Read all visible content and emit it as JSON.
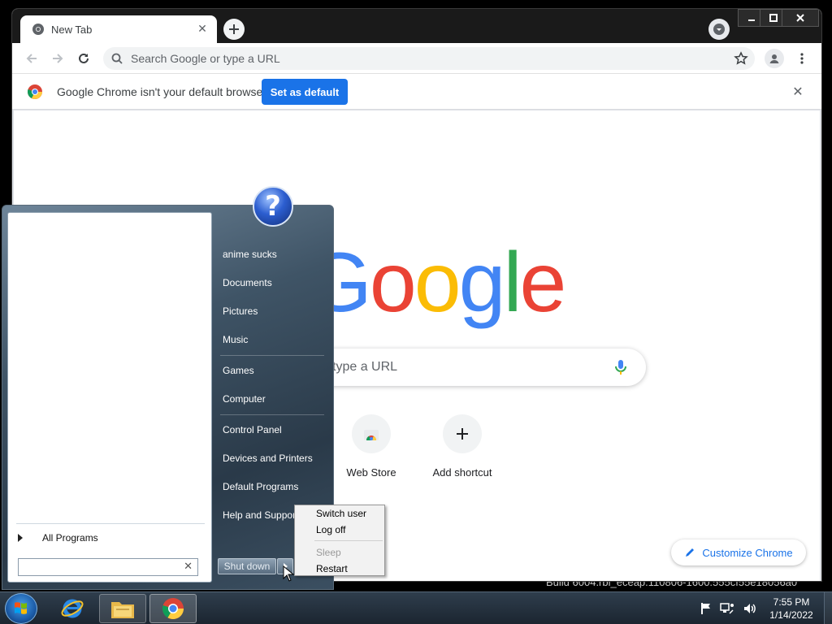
{
  "desktop": {
    "build_watermark": "Build 6004.rbi_eceap.110806-1600.555cf55e18056a0"
  },
  "chrome": {
    "tab_title": "New Tab",
    "omnibox_placeholder": "Search Google or type a URL",
    "infobar": {
      "message": "Google Chrome isn't your default browser",
      "button": "Set as default"
    },
    "ntp": {
      "logo_letters": [
        "G",
        "o",
        "o",
        "g",
        "l",
        "e"
      ],
      "logo_colors": [
        "#4285f4",
        "#ea4335",
        "#fbbc05",
        "#4285f4",
        "#34a853",
        "#ea4335"
      ],
      "search_placeholder": "type a URL",
      "shortcuts": [
        {
          "label": "Web Store",
          "icon": "web-store-icon"
        },
        {
          "label": "Add shortcut",
          "icon": "plus-icon"
        }
      ],
      "customize_label": "Customize Chrome"
    }
  },
  "start_menu": {
    "right_items": [
      "anime sucks",
      "Documents",
      "Pictures",
      "Music",
      "Games",
      "Computer",
      "Control Panel",
      "Devices and Printers",
      "Default Programs",
      "Help and Support"
    ],
    "all_programs": "All Programs",
    "shutdown_label": "Shut down"
  },
  "power_menu": {
    "items": [
      "Switch user",
      "Log off",
      "Sleep",
      "Restart"
    ],
    "disabled": [
      "Sleep"
    ]
  },
  "taskbar": {
    "time": "7:55 PM",
    "date": "1/14/2022"
  }
}
